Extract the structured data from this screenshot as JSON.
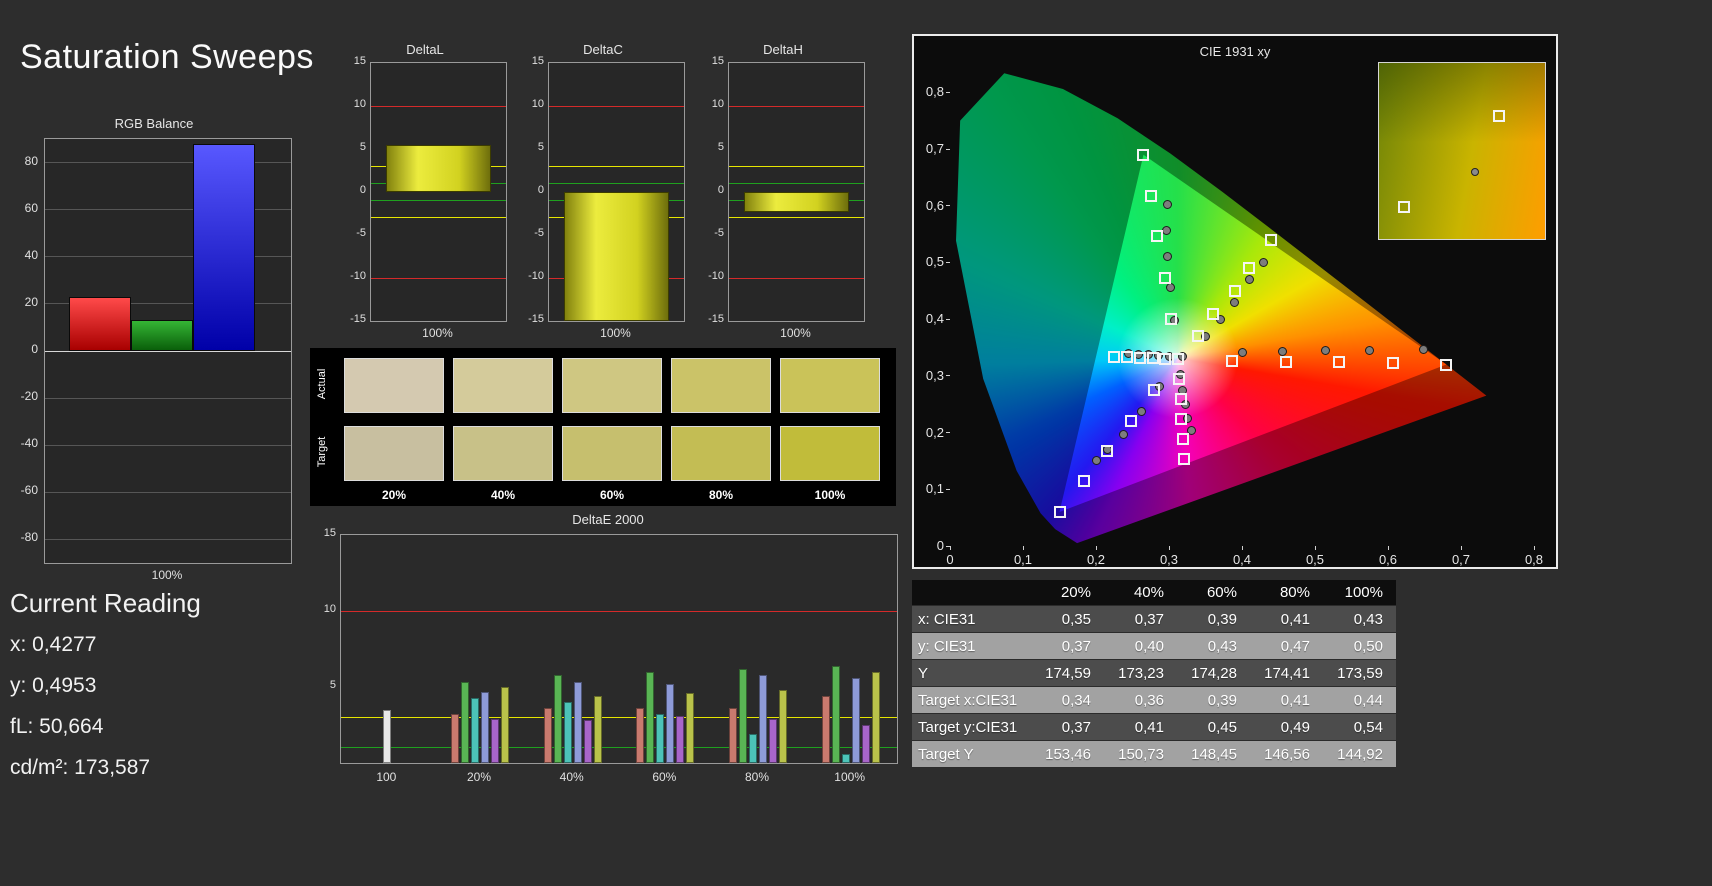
{
  "title": "Saturation Sweeps",
  "colors": {
    "background": "#2d2d2d",
    "limit_red": "#d42a2a",
    "limit_yellow": "#e6e600",
    "limit_green": "#1fa01f"
  },
  "rgb_balance": {
    "title": "RGB Balance",
    "x_label": "100%",
    "y_ticks": [
      80,
      60,
      40,
      20,
      0,
      -20,
      -40,
      -60,
      -80
    ],
    "y_range": [
      -90,
      90
    ],
    "bars": [
      {
        "name": "red",
        "value": 23,
        "c1": "#ff4a4a",
        "c2": "#a80000"
      },
      {
        "name": "green",
        "value": 13,
        "c1": "#35b535",
        "c2": "#0a5f0a"
      },
      {
        "name": "blue",
        "value": 88,
        "c1": "#5858ff",
        "c2": "#0000a8"
      }
    ]
  },
  "current_reading": {
    "title": "Current Reading",
    "lines": [
      "x: 0,4277",
      "y: 0,4953",
      "fL: 50,664",
      "cd/m²: 173,587"
    ]
  },
  "delta_charts": [
    {
      "title": "DeltaL",
      "x_label": "100%",
      "value": 5.5
    },
    {
      "title": "DeltaC",
      "x_label": "100%",
      "value": -15
    },
    {
      "title": "DeltaH",
      "x_label": "100%",
      "value": -2.3
    }
  ],
  "delta_axis": {
    "ticks": [
      15,
      10,
      5,
      0,
      -5,
      -10,
      -15
    ],
    "range": [
      -15,
      15
    ],
    "limits": [
      {
        "v": 10,
        "c": "red"
      },
      {
        "v": 3,
        "c": "yellow"
      },
      {
        "v": 1,
        "c": "green"
      },
      {
        "v": -1,
        "c": "green"
      },
      {
        "v": -3,
        "c": "yellow"
      },
      {
        "v": -10,
        "c": "red"
      }
    ]
  },
  "swatches": {
    "row_labels": [
      "Actual",
      "Target"
    ],
    "col_labels": [
      "20%",
      "40%",
      "60%",
      "80%",
      "100%"
    ],
    "actual": [
      "#d4c9b0",
      "#d4cb9b",
      "#cfc782",
      "#cbc368",
      "#cac359"
    ],
    "target": [
      "#c8bfa0",
      "#c8c188",
      "#c6bf6e",
      "#c3bd54",
      "#c1bc3a"
    ]
  },
  "deltae_chart": {
    "title": "DeltaE 2000",
    "y_ticks": [
      15,
      10,
      5
    ],
    "y_range": [
      0,
      15
    ],
    "limits": [
      {
        "v": 10,
        "c": "red"
      },
      {
        "v": 3,
        "c": "yellow"
      },
      {
        "v": 1,
        "c": "green"
      }
    ],
    "series_colors": {
      "white": "#e8e8e8",
      "red": "#c97a6e",
      "green": "#59b554",
      "cyan": "#4cc3b8",
      "blue": "#8e9bd8",
      "magenta": "#a865c9",
      "yellow": "#b9c24a"
    },
    "groups": [
      {
        "label": "100",
        "bars": [
          {
            "c": "white",
            "v": 3.5
          }
        ]
      },
      {
        "label": "20%",
        "bars": [
          {
            "c": "red",
            "v": 3.2
          },
          {
            "c": "green",
            "v": 5.3
          },
          {
            "c": "cyan",
            "v": 4.3
          },
          {
            "c": "blue",
            "v": 4.7
          },
          {
            "c": "magenta",
            "v": 2.9
          },
          {
            "c": "yellow",
            "v": 5.0
          }
        ]
      },
      {
        "label": "40%",
        "bars": [
          {
            "c": "red",
            "v": 3.6
          },
          {
            "c": "green",
            "v": 5.8
          },
          {
            "c": "cyan",
            "v": 4.0
          },
          {
            "c": "blue",
            "v": 5.3
          },
          {
            "c": "magenta",
            "v": 2.8
          },
          {
            "c": "yellow",
            "v": 4.4
          }
        ]
      },
      {
        "label": "60%",
        "bars": [
          {
            "c": "red",
            "v": 3.6
          },
          {
            "c": "green",
            "v": 6.0
          },
          {
            "c": "cyan",
            "v": 3.2
          },
          {
            "c": "blue",
            "v": 5.2
          },
          {
            "c": "magenta",
            "v": 3.1
          },
          {
            "c": "yellow",
            "v": 4.6
          }
        ]
      },
      {
        "label": "80%",
        "bars": [
          {
            "c": "red",
            "v": 3.6
          },
          {
            "c": "green",
            "v": 6.2
          },
          {
            "c": "cyan",
            "v": 1.9
          },
          {
            "c": "blue",
            "v": 5.8
          },
          {
            "c": "magenta",
            "v": 2.9
          },
          {
            "c": "yellow",
            "v": 4.8
          }
        ]
      },
      {
        "label": "100%",
        "bars": [
          {
            "c": "red",
            "v": 4.4
          },
          {
            "c": "green",
            "v": 6.4
          },
          {
            "c": "cyan",
            "v": 0.6
          },
          {
            "c": "blue",
            "v": 5.6
          },
          {
            "c": "magenta",
            "v": 2.5
          },
          {
            "c": "yellow",
            "v": 6.0
          }
        ]
      }
    ]
  },
  "cie_chart": {
    "title": "CIE 1931 xy",
    "x_ticks": [
      "0",
      "0,1",
      "0,2",
      "0,3",
      "0,4",
      "0,5",
      "0,6",
      "0,7",
      "0,8"
    ],
    "y_ticks": [
      "0",
      "0,1",
      "0,2",
      "0,3",
      "0,4",
      "0,5",
      "0,6",
      "0,7",
      "0,8"
    ],
    "x_max": 0.8,
    "y_max": 0.85,
    "white_point": [
      0.313,
      0.329
    ],
    "triangle": [
      [
        0.68,
        0.32
      ],
      [
        0.265,
        0.69
      ],
      [
        0.15,
        0.06
      ]
    ],
    "targets": [
      [
        0.313,
        0.329
      ],
      [
        0.386,
        0.327
      ],
      [
        0.46,
        0.325
      ],
      [
        0.533,
        0.324
      ],
      [
        0.607,
        0.322
      ],
      [
        0.68,
        0.32
      ],
      [
        0.303,
        0.401
      ],
      [
        0.294,
        0.473
      ],
      [
        0.284,
        0.546
      ],
      [
        0.275,
        0.618
      ],
      [
        0.265,
        0.69
      ],
      [
        0.28,
        0.275
      ],
      [
        0.248,
        0.221
      ],
      [
        0.215,
        0.168
      ],
      [
        0.183,
        0.114
      ],
      [
        0.15,
        0.06
      ],
      [
        0.34,
        0.37
      ],
      [
        0.36,
        0.41
      ],
      [
        0.39,
        0.45
      ],
      [
        0.41,
        0.49
      ],
      [
        0.44,
        0.54
      ],
      [
        0.295,
        0.33
      ],
      [
        0.278,
        0.331
      ],
      [
        0.26,
        0.332
      ],
      [
        0.243,
        0.333
      ],
      [
        0.225,
        0.334
      ],
      [
        0.314,
        0.294
      ],
      [
        0.316,
        0.259
      ],
      [
        0.317,
        0.224
      ],
      [
        0.319,
        0.189
      ],
      [
        0.32,
        0.154
      ]
    ],
    "measurements": [
      [
        0.318,
        0.334
      ],
      [
        0.4,
        0.341
      ],
      [
        0.455,
        0.343
      ],
      [
        0.515,
        0.344
      ],
      [
        0.575,
        0.345
      ],
      [
        0.648,
        0.346
      ],
      [
        0.307,
        0.398
      ],
      [
        0.302,
        0.455
      ],
      [
        0.298,
        0.51
      ],
      [
        0.296,
        0.556
      ],
      [
        0.298,
        0.602
      ],
      [
        0.287,
        0.282
      ],
      [
        0.262,
        0.238
      ],
      [
        0.238,
        0.196
      ],
      [
        0.216,
        0.17
      ],
      [
        0.2,
        0.15
      ],
      [
        0.35,
        0.37
      ],
      [
        0.37,
        0.4
      ],
      [
        0.39,
        0.43
      ],
      [
        0.41,
        0.47
      ],
      [
        0.43,
        0.5
      ],
      [
        0.3,
        0.335
      ],
      [
        0.286,
        0.336
      ],
      [
        0.272,
        0.337
      ],
      [
        0.258,
        0.338
      ],
      [
        0.245,
        0.339
      ],
      [
        0.316,
        0.302
      ],
      [
        0.319,
        0.275
      ],
      [
        0.322,
        0.25
      ],
      [
        0.326,
        0.225
      ],
      [
        0.331,
        0.203
      ]
    ],
    "inset": {
      "markers": [
        {
          "type": "square",
          "x": 72,
          "y": 30
        },
        {
          "type": "circle",
          "x": 58,
          "y": 62
        },
        {
          "type": "square",
          "x": 15,
          "y": 82
        }
      ]
    }
  },
  "table": {
    "header": [
      "",
      "20%",
      "40%",
      "60%",
      "80%",
      "100%"
    ],
    "rows": [
      {
        "label": "x: CIE31",
        "values": [
          "0,35",
          "0,37",
          "0,39",
          "0,41",
          "0,43"
        ]
      },
      {
        "label": "y: CIE31",
        "values": [
          "0,37",
          "0,40",
          "0,43",
          "0,47",
          "0,50"
        ]
      },
      {
        "label": "Y",
        "values": [
          "174,59",
          "173,23",
          "174,28",
          "174,41",
          "173,59"
        ]
      },
      {
        "label": "Target x:CIE31",
        "values": [
          "0,34",
          "0,36",
          "0,39",
          "0,41",
          "0,44"
        ]
      },
      {
        "label": "Target y:CIE31",
        "values": [
          "0,37",
          "0,41",
          "0,45",
          "0,49",
          "0,54"
        ]
      },
      {
        "label": "Target Y",
        "values": [
          "153,46",
          "150,73",
          "148,45",
          "146,56",
          "144,92"
        ]
      }
    ]
  }
}
